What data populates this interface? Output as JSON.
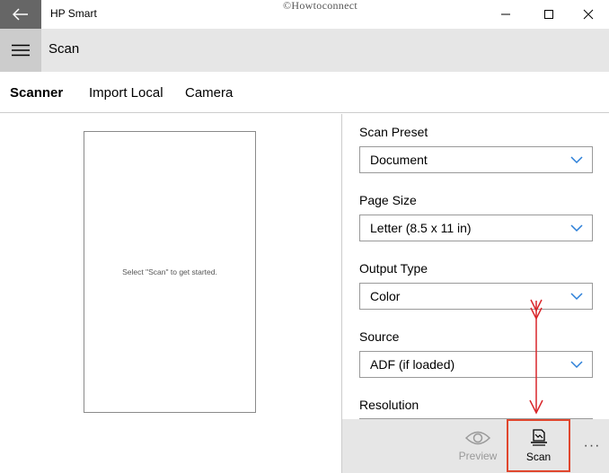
{
  "window": {
    "title": "HP Smart",
    "watermark": "©Howtoconnect"
  },
  "header": {
    "title": "Scan"
  },
  "tabs": [
    {
      "label": "Scanner",
      "active": true
    },
    {
      "label": "Import Local",
      "active": false
    },
    {
      "label": "Camera",
      "active": false
    }
  ],
  "preview": {
    "hint": "Select \"Scan\" to get started."
  },
  "settings": {
    "scan_preset": {
      "label": "Scan Preset",
      "value": "Document"
    },
    "page_size": {
      "label": "Page Size",
      "value": "Letter (8.5 x 11 in)"
    },
    "output_type": {
      "label": "Output Type",
      "value": "Color"
    },
    "source": {
      "label": "Source",
      "value": "ADF (if loaded)"
    },
    "resolution": {
      "label": "Resolution"
    }
  },
  "commandbar": {
    "preview_label": "Preview",
    "scan_label": "Scan",
    "more_label": "···"
  },
  "colors": {
    "accent_chevron": "#2b7fd8",
    "highlight": "#e0462d",
    "back_button_bg": "#666666"
  },
  "icons": {
    "back": "arrow-left-icon",
    "menu": "hamburger-icon",
    "minimize": "minimize-icon",
    "maximize": "maximize-icon",
    "close": "close-icon",
    "preview": "eye-icon",
    "scan": "scan-document-icon"
  }
}
